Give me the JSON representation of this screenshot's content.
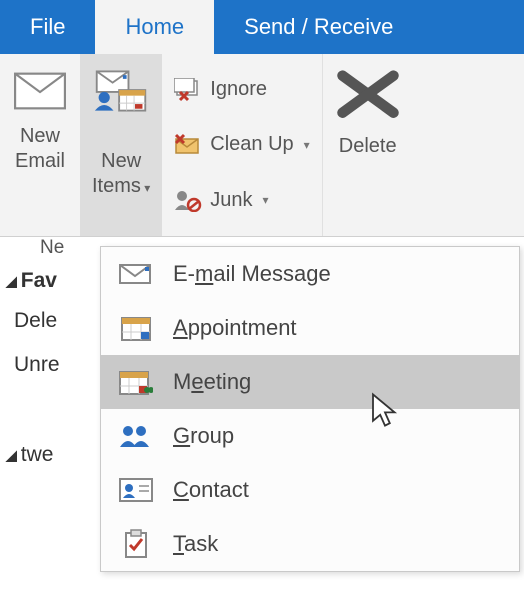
{
  "tabs": {
    "file": "File",
    "home": "Home",
    "send_receive": "Send / Receive"
  },
  "ribbon": {
    "new_email": "New\nEmail",
    "new_items": "New\nItems",
    "ignore": "Ignore",
    "clean_up": "Clean Up",
    "junk": "Junk",
    "delete": "Delete"
  },
  "nav": {
    "new_group_label": "Ne",
    "favorites": "Fav",
    "deleted": "Dele",
    "unread": "Unre",
    "tweets": "twe"
  },
  "menu": {
    "email": {
      "pre": "E-",
      "u": "m",
      "post": "ail Message"
    },
    "appointment": {
      "pre": "",
      "u": "A",
      "post": "ppointment"
    },
    "meeting": {
      "pre": "M",
      "u": "e",
      "post": "eting"
    },
    "group": {
      "pre": "",
      "u": "G",
      "post": "roup"
    },
    "contact": {
      "pre": "",
      "u": "C",
      "post": "ontact"
    },
    "task": {
      "pre": "",
      "u": "T",
      "post": "ask"
    }
  }
}
